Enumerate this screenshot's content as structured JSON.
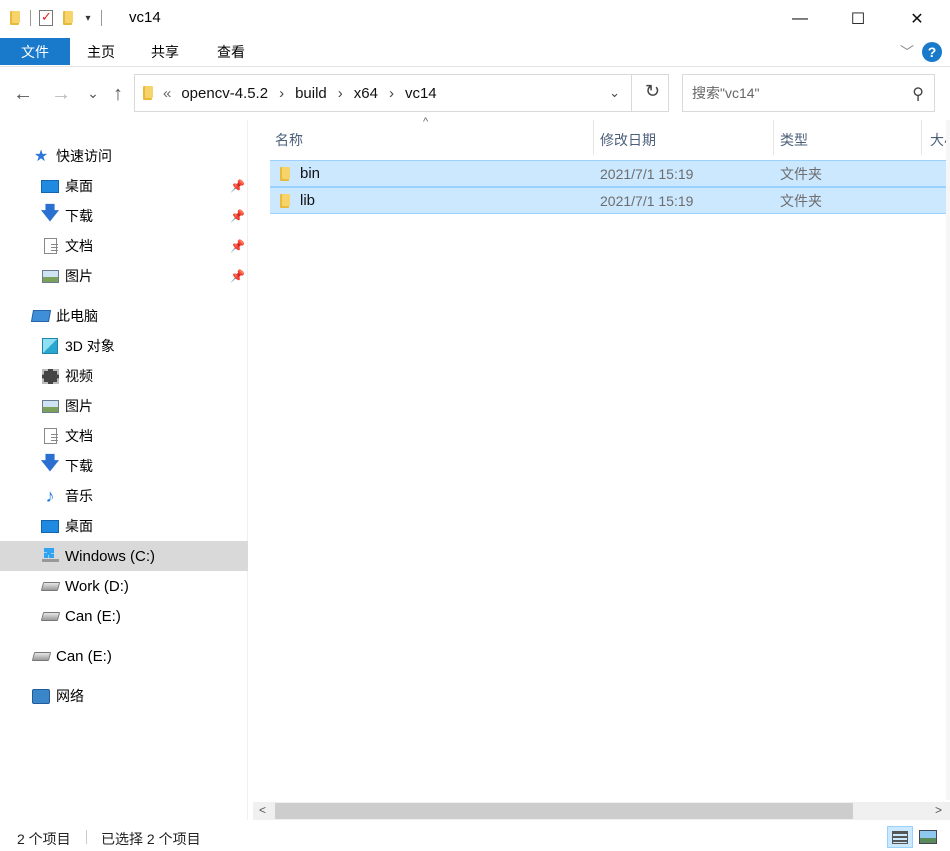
{
  "window": {
    "title": "vc14",
    "minimize_glyph": "—",
    "maximize_glyph": "☐",
    "close_glyph": "✕"
  },
  "ribbon": {
    "tabs": [
      "文件",
      "主页",
      "共享",
      "查看"
    ],
    "accent_color": "#1979ca",
    "expand_glyph": "﹀",
    "help_glyph": "?"
  },
  "nav": {
    "back_glyph": "←",
    "forward_glyph": "→",
    "recent_glyph": "⌄",
    "up_glyph": "↑",
    "breadcrumb_overflow": "«",
    "breadcrumbs": [
      "opencv-4.5.2",
      "build",
      "x64",
      "vc14"
    ],
    "crumb_separator": "›",
    "dropdown_glyph": "⌄",
    "refresh_glyph": "↻",
    "search_placeholder": "搜索\"vc14\"",
    "search_glyph": "⚲"
  },
  "sidebar": {
    "quick_access": {
      "label": "快速访问",
      "icon": "star-icon",
      "items": [
        {
          "label": "桌面",
          "icon": "desktop-icon",
          "pinned": true
        },
        {
          "label": "下载",
          "icon": "download-icon",
          "pinned": true
        },
        {
          "label": "文档",
          "icon": "document-icon",
          "pinned": true
        },
        {
          "label": "图片",
          "icon": "pictures-icon",
          "pinned": true
        }
      ]
    },
    "this_pc": {
      "label": "此电脑",
      "icon": "computer-icon",
      "items": [
        {
          "label": "3D 对象",
          "icon": "3d-objects-icon"
        },
        {
          "label": "视频",
          "icon": "video-icon"
        },
        {
          "label": "图片",
          "icon": "pictures-icon"
        },
        {
          "label": "文档",
          "icon": "document-icon"
        },
        {
          "label": "下载",
          "icon": "download-icon"
        },
        {
          "label": "音乐",
          "icon": "music-icon"
        },
        {
          "label": "桌面",
          "icon": "desktop-icon"
        },
        {
          "label": "Windows (C:)",
          "icon": "windows-drive-icon",
          "selected": true
        },
        {
          "label": "Work (D:)",
          "icon": "drive-icon"
        },
        {
          "label": "Can (E:)",
          "icon": "drive-icon"
        }
      ]
    },
    "removable": {
      "label": "Can (E:)",
      "icon": "drive-icon"
    },
    "network": {
      "label": "网络",
      "icon": "network-icon"
    },
    "pin_glyph": "📌",
    "star_glyph": "★",
    "download_glyph": "🡇",
    "music_glyph": "♪"
  },
  "file_list": {
    "columns": [
      "名称",
      "修改日期",
      "类型",
      "大小"
    ],
    "sort_glyph": "^",
    "rows": [
      {
        "name": "bin",
        "modified": "2021/7/1 15:19",
        "type": "文件夹",
        "selected": true
      },
      {
        "name": "lib",
        "modified": "2021/7/1 15:19",
        "type": "文件夹",
        "selected": true
      }
    ],
    "selection_color": "#cce8ff"
  },
  "scrollbar": {
    "left_glyph": "<",
    "right_glyph": ">"
  },
  "status": {
    "item_count": "2 个项目",
    "selected_count": "已选择 2 个项目",
    "view_modes": [
      "details-view-icon",
      "large-icons-view-icon"
    ],
    "active_view": "details-view-icon"
  }
}
